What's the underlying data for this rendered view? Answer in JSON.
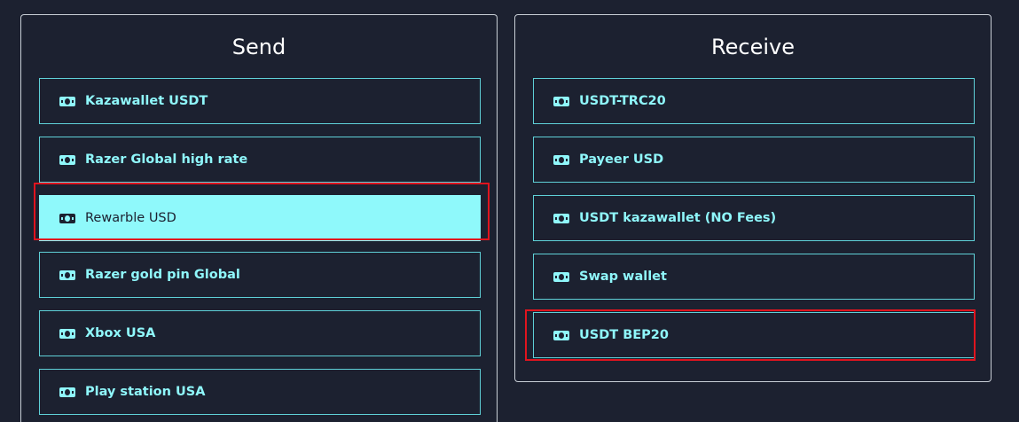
{
  "send": {
    "title": "Send",
    "items": [
      {
        "label": "Kazawallet USDT"
      },
      {
        "label": "Razer Global high rate"
      },
      {
        "label": "Rewarble USD"
      },
      {
        "label": "Razer gold pin Global"
      },
      {
        "label": "Xbox USA"
      },
      {
        "label": "Play station USA"
      }
    ],
    "selected": "Rewarble USD"
  },
  "receive": {
    "title": "Receive",
    "items": [
      {
        "label": "USDT-TRC20"
      },
      {
        "label": "Payeer USD"
      },
      {
        "label": "USDT kazawallet (NO Fees)"
      },
      {
        "label": "Swap wallet"
      },
      {
        "label": "USDT BEP20"
      }
    ]
  },
  "icons": {
    "option": "money-bill-icon"
  },
  "colors": {
    "background": "#1c2130",
    "accent": "#8ff7fb",
    "highlight": "#e0141e"
  }
}
